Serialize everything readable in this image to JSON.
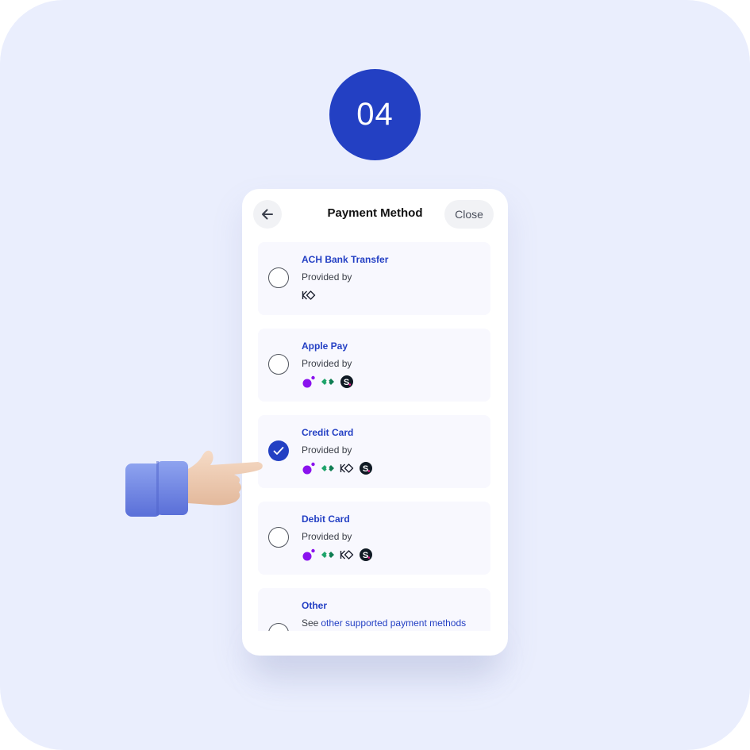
{
  "step": {
    "number": "04"
  },
  "screen": {
    "header": {
      "back_label": "Back",
      "title": "Payment Method",
      "close_label": "Close"
    },
    "options": [
      {
        "title": "ACH Bank Transfer",
        "subtitle": "Provided by",
        "selected": false,
        "providers": [
          "kanmon-diamond-icon"
        ]
      },
      {
        "title": "Apple Pay",
        "subtitle": "Provided by",
        "selected": false,
        "providers": [
          "purple-dots-icon",
          "green-diamond-icon",
          "s-circle-icon"
        ]
      },
      {
        "title": "Credit Card",
        "subtitle": "Provided by",
        "selected": true,
        "providers": [
          "purple-dots-icon",
          "green-diamond-icon",
          "kanmon-diamond-icon",
          "s-circle-icon"
        ]
      },
      {
        "title": "Debit Card",
        "subtitle": "Provided by",
        "selected": false,
        "providers": [
          "purple-dots-icon",
          "green-diamond-icon",
          "kanmon-diamond-icon",
          "s-circle-icon"
        ]
      },
      {
        "title": "Other",
        "subtitle_prefix": "See",
        "subtitle_link": "other supported payment methods",
        "selected": false
      }
    ]
  },
  "colors": {
    "accent": "#2340c3",
    "background": "#eaeefd",
    "card": "#f8f8fe",
    "link": "#2440c4"
  }
}
